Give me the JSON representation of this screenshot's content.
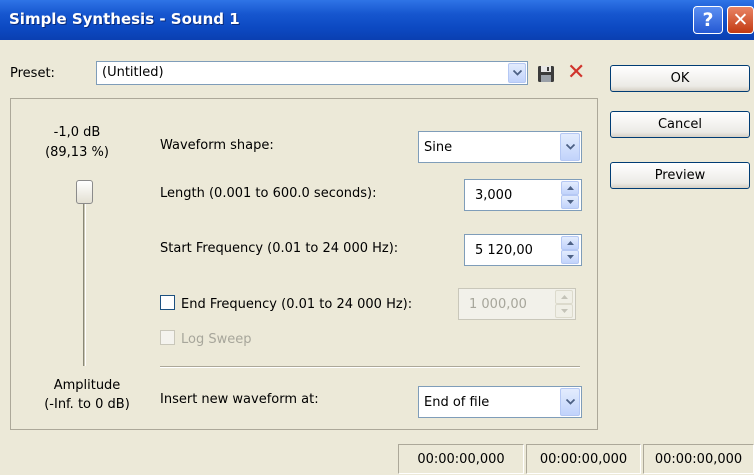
{
  "window": {
    "title": "Simple Synthesis - Sound 1",
    "help_label": "?",
    "close_label": "✕"
  },
  "preset": {
    "label": "Preset:",
    "value": "(Untitled)",
    "save_icon": "save-icon",
    "delete_icon": "delete-icon",
    "delete_glyph": "✕"
  },
  "buttons": {
    "ok": "OK",
    "cancel": "Cancel",
    "preview": "Preview"
  },
  "amplitude": {
    "value": "-1,0 dB",
    "percent": "(89,13 %)",
    "label": "Amplitude",
    "range": "(-Inf. to 0 dB)",
    "slider_level": 0.89
  },
  "waveform": {
    "label": "Waveform shape:",
    "value": "Sine"
  },
  "length": {
    "label": "Length (0.001 to 600.0 seconds):",
    "value": "3,000"
  },
  "start_frequency": {
    "label": "Start Frequency (0.01 to 24 000 Hz):",
    "value": "5 120,00"
  },
  "end_frequency": {
    "label": "End Frequency (0.01 to 24 000 Hz):",
    "value": "1 000,00",
    "checked": false,
    "enabled": false
  },
  "log_sweep": {
    "label": "Log Sweep",
    "checked": false,
    "enabled": false
  },
  "insert": {
    "label": "Insert new waveform at:",
    "value": "End of file"
  },
  "status": [
    "00:00:00,000",
    "00:00:00,000",
    "00:00:00,000"
  ],
  "colors": {
    "titlebar": "#0c49c2",
    "dialog_bg": "#ece9d8",
    "delete_red": "#d0342c"
  }
}
